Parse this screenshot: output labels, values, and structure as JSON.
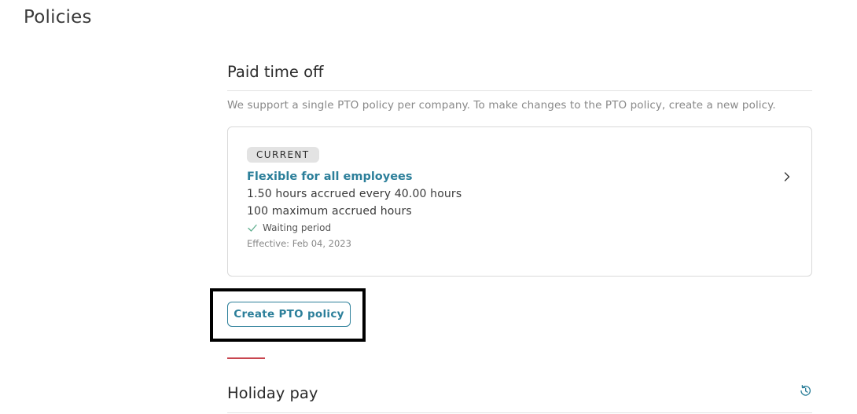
{
  "page": {
    "title": "Policies"
  },
  "pto": {
    "heading": "Paid time off",
    "description": "We support a single PTO policy per company. To make changes to the PTO policy, create a new policy.",
    "current_policy": {
      "badge": "CURRENT",
      "name": "Flexible for all employees",
      "accrual": "1.50 hours accrued every 40.00 hours",
      "max_accrued": "100 maximum accrued hours",
      "waiting_period": "Waiting period",
      "effective": "Effective: Feb 04, 2023"
    },
    "create_button_label": "Create PTO policy"
  },
  "holiday": {
    "heading": "Holiday pay"
  },
  "icons": {
    "policy_chevron": "chevron-right-icon",
    "waiting_check": "check-icon",
    "holiday_history": "history-icon"
  },
  "colors": {
    "accent": "#2c7f9a",
    "check": "#5fae8e",
    "divider_red": "#c8454f",
    "badge_bg": "#e3e3e3",
    "highlight_box": "#000000"
  }
}
